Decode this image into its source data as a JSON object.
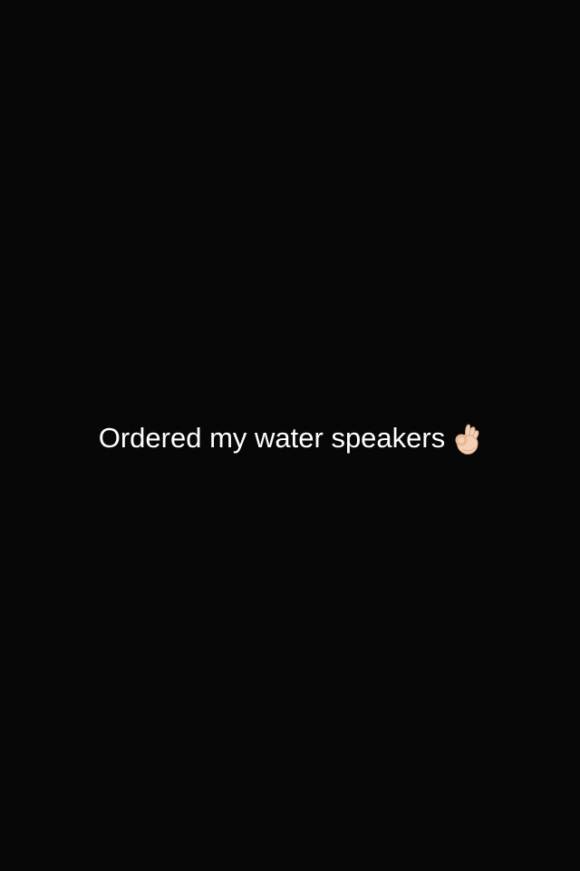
{
  "snap": {
    "caption_text": "Ordered my water speakers",
    "caption_emoji": "ok-hand-icon"
  },
  "colors": {
    "background": "#070707",
    "caption_text": "#ffffff",
    "emoji_skin": "#f3d0b6"
  }
}
